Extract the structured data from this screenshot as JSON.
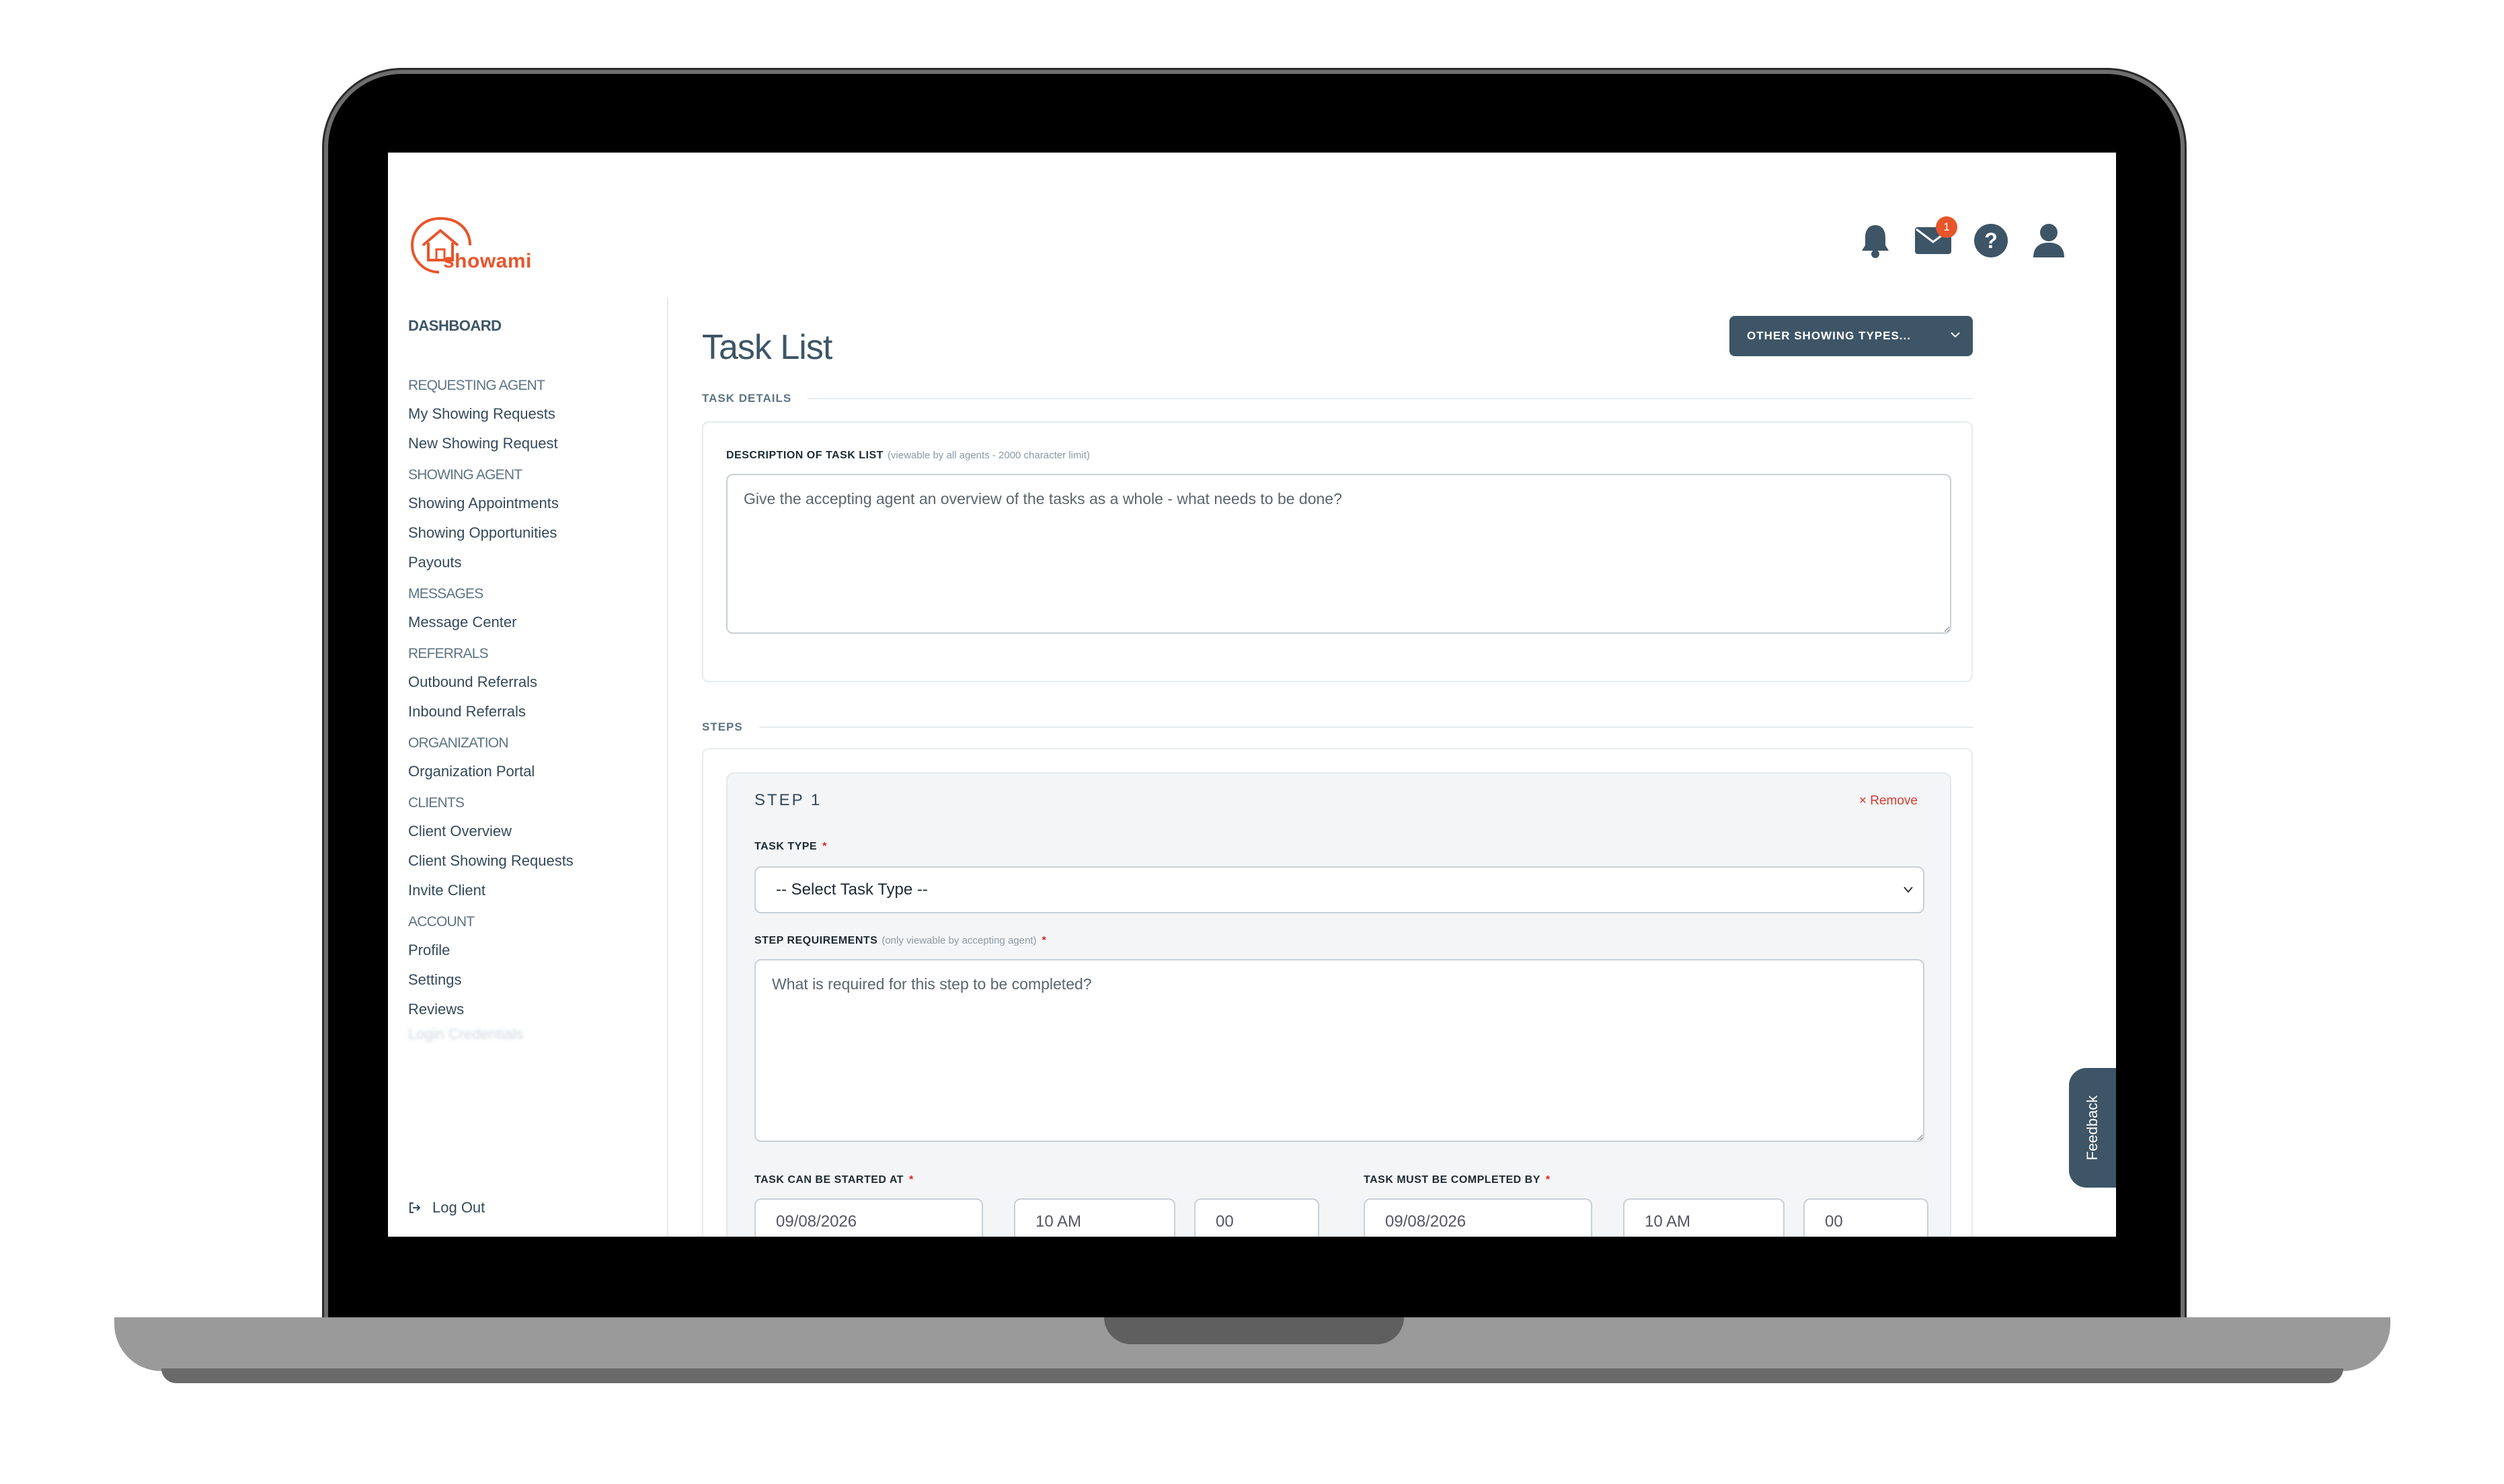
{
  "brand": {
    "name": "showami",
    "color": "#e8552b"
  },
  "header": {
    "icons": [
      "bell-icon",
      "mail-icon",
      "help-icon",
      "user-icon"
    ],
    "mail_badge": "1"
  },
  "sidebar": {
    "dashboard": "DASHBOARD",
    "sections": [
      {
        "heading": "REQUESTING AGENT",
        "links": [
          "My Showing Requests",
          "New Showing Request"
        ]
      },
      {
        "heading": "SHOWING AGENT",
        "links": [
          "Showing Appointments",
          "Showing Opportunities",
          "Payouts"
        ]
      },
      {
        "heading": "MESSAGES",
        "links": [
          "Message Center"
        ]
      },
      {
        "heading": "REFERRALS",
        "links": [
          "Outbound Referrals",
          "Inbound Referrals"
        ]
      },
      {
        "heading": "ORGANIZATION",
        "links": [
          "Organization Portal"
        ]
      },
      {
        "heading": "CLIENTS",
        "links": [
          "Client Overview",
          "Client Showing Requests",
          "Invite Client"
        ]
      },
      {
        "heading": "ACCOUNT",
        "links": [
          "Profile",
          "Settings",
          "Reviews"
        ]
      }
    ],
    "blurred_link": "Login Credentials",
    "logout": "Log Out"
  },
  "main": {
    "title": "Task List",
    "types_button": "OTHER SHOWING TYPES...",
    "task_details_label": "TASK DETAILS",
    "description_label": "DESCRIPTION OF TASK LIST",
    "description_hint": "(viewable by all agents - 2000 character limit)",
    "description_placeholder": "Give the accepting agent an overview of the tasks as a whole - what needs to be done?",
    "steps_label": "STEPS",
    "step": {
      "title": "STEP 1",
      "remove": "× Remove",
      "task_type_label": "TASK TYPE",
      "task_type_value": "-- Select Task Type --",
      "requirements_label": "STEP REQUIREMENTS",
      "requirements_hint": "(only viewable by accepting agent)",
      "requirements_placeholder": "What is required for this step to be completed?",
      "start_label": "TASK CAN BE STARTED AT",
      "complete_label": "TASK MUST BE COMPLETED BY",
      "start_date": "09/08/2026",
      "start_hour": "10 AM",
      "start_minute": "00",
      "end_date": "09/08/2026",
      "end_hour": "10 AM",
      "end_minute": "00"
    }
  },
  "feedback_tab": "Feedback"
}
